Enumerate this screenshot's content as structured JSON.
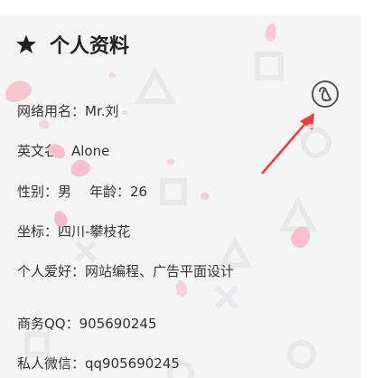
{
  "profile": {
    "title": "个人资料",
    "nickname": "网络用名：Mr.刘",
    "english_name": "英文名：Alone",
    "gender": "性别：男",
    "age": "年龄：26",
    "location": "坐标：四川-攀枝花",
    "hobbies": "个人爱好：网站编程、广告平面设计",
    "qq": "商务QQ：905690245",
    "wechat": "私人微信：qq905690245"
  },
  "icons": {
    "title_icon": "star-icon",
    "link_icon": "link-circle-icon",
    "annotation": "red-arrow"
  },
  "colors": {
    "card_bg": "#f5f5f6",
    "text": "#333333",
    "title": "#222222",
    "arrow": "#f23b3b",
    "petal": "#f6c1cc",
    "bg_shapes": "#e9e9ec"
  }
}
